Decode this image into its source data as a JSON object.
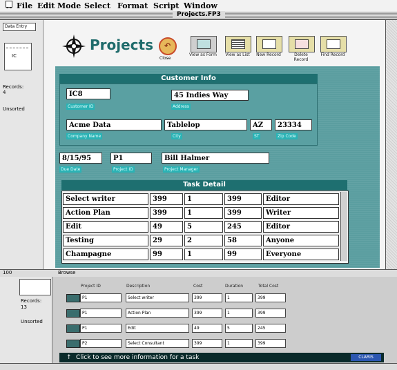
{
  "menubar": {
    "apple": "⌘",
    "items": [
      "File",
      "Edit",
      "Mode",
      "Select",
      "Format",
      "Script",
      "Window"
    ]
  },
  "window": {
    "title": "Projects.FP3"
  },
  "status": {
    "layout_name": "Data Entry",
    "book_label": "IC",
    "records_label": "Records:",
    "records_count": "4",
    "sort_state": "Unsorted"
  },
  "header": {
    "app_title": "Projects",
    "close_label": "Close",
    "toolbar": [
      {
        "label": "View as Form"
      },
      {
        "label": "View as List"
      },
      {
        "label": "New Record"
      },
      {
        "label": "Delete Record"
      },
      {
        "label": "Find Record"
      }
    ]
  },
  "customer": {
    "header": "Customer Info",
    "customer_id": "IC8",
    "customer_id_label": "Customer ID",
    "address": "45 Indies Way",
    "address_label": "Address",
    "company": "Acme Data",
    "company_label": "Company Name",
    "city": "Tablelop",
    "city_label": "City",
    "state": "AZ",
    "state_label": "ST",
    "zip": "23334",
    "zip_label": "Zip Code"
  },
  "project": {
    "due_date": "8/15/95",
    "due_date_label": "Due Date",
    "project_id": "P1",
    "project_id_label": "Project ID",
    "manager": "Bill Halmer",
    "manager_label": "Project Manager"
  },
  "task_detail": {
    "header": "Task Detail",
    "rows": [
      [
        "Select writer",
        "399",
        "1",
        "399",
        "Editor"
      ],
      [
        "Action Plan",
        "399",
        "1",
        "399",
        "Writer"
      ],
      [
        "Edit",
        "49",
        "5",
        "245",
        "Editor"
      ],
      [
        "Testing",
        "29",
        "2",
        "58",
        "Anyone"
      ],
      [
        "Champagne",
        "99",
        "1",
        "99",
        "Everyone"
      ]
    ]
  },
  "modebar": {
    "zoom": "100",
    "mode": "Browse"
  },
  "list_window": {
    "records_label": "Records:",
    "records_count": "13",
    "sort_state": "Unsorted",
    "headers": [
      "Project ID",
      "Description",
      "Cost",
      "Duration",
      "Total Cost"
    ],
    "rows": [
      [
        "P1",
        "Select writer",
        "399",
        "1",
        "399"
      ],
      [
        "P1",
        "Action Plan",
        "399",
        "1",
        "399"
      ],
      [
        "P1",
        "Edit",
        "49",
        "5",
        "245"
      ],
      [
        "P2",
        "Select Consultant",
        "399",
        "1",
        "399"
      ]
    ]
  },
  "hint": {
    "arrow": "↑",
    "text": "Click to see more information for a task",
    "button": "CLARIS"
  },
  "colors": {
    "teal_panel": "#5b9ea0",
    "band_header": "#1e6f70",
    "field_label": "#2ab3b5",
    "title_teal": "#1e6b6b"
  }
}
